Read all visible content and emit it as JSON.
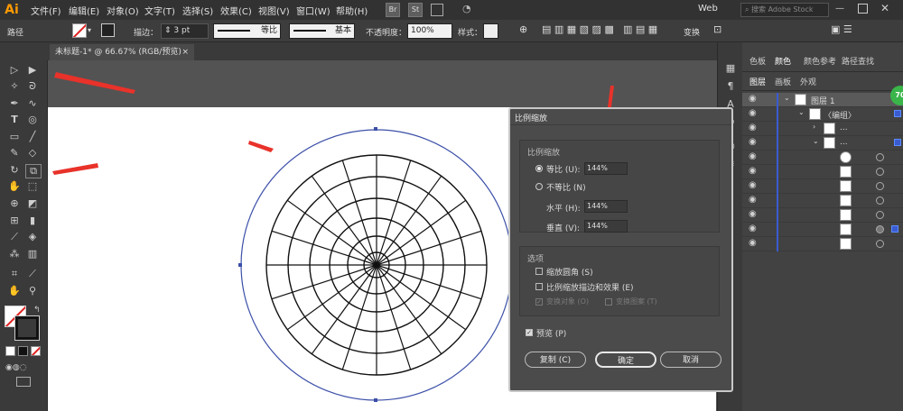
{
  "app": {
    "logo": "Ai",
    "workspace": "Web",
    "search_placeholder": "搜索 Adobe Stock"
  },
  "menu": [
    "文件(F)",
    "编辑(E)",
    "对象(O)",
    "文字(T)",
    "选择(S)",
    "效果(C)",
    "视图(V)",
    "窗口(W)",
    "帮助(H)"
  ],
  "menu_badges": [
    "Br",
    "St"
  ],
  "control_bar": {
    "selection_label": "路径",
    "stroke_label": "描边：",
    "stroke_value": "3 pt",
    "profile_label": "等比",
    "brush_label": "基本",
    "opacity_label": "不透明度：",
    "opacity_value": "100%",
    "style_label": "样式：",
    "transform_label": "变换"
  },
  "document_tab": {
    "title": "未标题-1* @ 66.67% (RGB/预览)",
    "close": "×"
  },
  "panel": {
    "tabs_top": [
      "色板",
      "颜色",
      "颜色参考",
      "路径查找"
    ],
    "tabs_layer": [
      "图层",
      "画板",
      "外观"
    ],
    "rows": [
      {
        "label": "图层 1"
      },
      {
        "label": "〈编组〉"
      },
      {
        "label": "..."
      },
      {
        "label": "..."
      },
      {
        "label": ""
      },
      {
        "label": ""
      },
      {
        "label": ""
      },
      {
        "label": ""
      },
      {
        "label": ""
      },
      {
        "label": ""
      },
      {
        "label": ""
      }
    ],
    "badge": "70"
  },
  "dialog": {
    "title": "比例缩放",
    "group_scale": "比例缩放",
    "uniform_label": "等比 (U):",
    "uniform_value": "144%",
    "nonuniform_label": "不等比 (N)",
    "horizontal_label": "水平 (H):",
    "horizontal_value": "144%",
    "vertical_label": "垂直 (V):",
    "vertical_value": "144%",
    "group_options": "选项",
    "opt_corners": "缩放圆角 (S)",
    "opt_strokes": "比例缩放描边和效果 (E)",
    "opt_objects": "变换对象 (O)",
    "opt_patterns": "变换图案 (T)",
    "preview_label": "预览 (P)",
    "copy_button": "复制 (C)",
    "ok_button": "确定",
    "cancel_button": "取消"
  },
  "colors": {
    "accent_arrow": "#e8322a",
    "selection_blue": "#3b4fa8",
    "badge_green": "#3ab54a"
  }
}
